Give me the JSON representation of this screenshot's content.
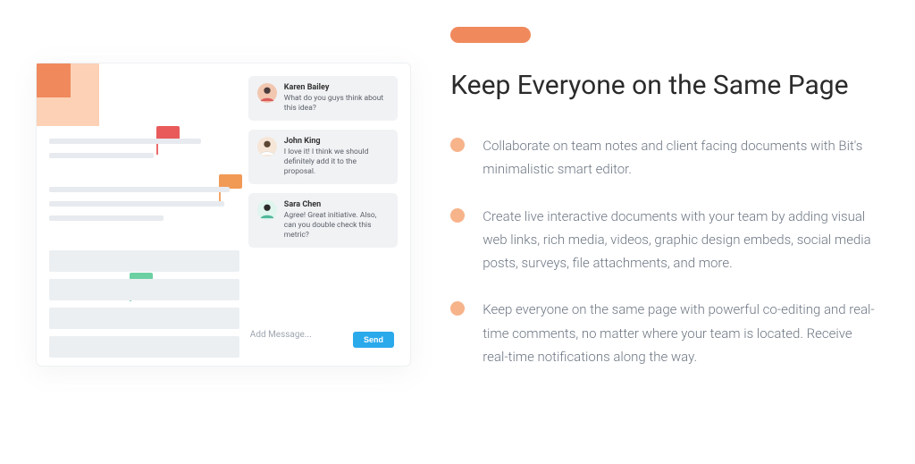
{
  "headline": "Keep Everyone on the Same Page",
  "features": [
    "Collaborate on team notes and client facing documents with Bit's minimalistic smart editor.",
    "Create live interactive documents with your team by adding visual web links, rich media, videos, graphic design embeds, social media posts, surveys, file attachments, and more.",
    "Keep everyone on the same page with powerful co-editing and real-time comments, no matter where your team is located. Receive real-time notifications along the way."
  ],
  "comments": [
    {
      "name": "Karen Bailey",
      "text": "What do you guys think about this idea?"
    },
    {
      "name": "John King",
      "text": "I love it! I think we should definitely add it to the proposal."
    },
    {
      "name": "Sara Chen",
      "text": "Agree! Great initiative. Also, can you double check this metric?"
    }
  ],
  "compose": {
    "placeholder": "Add Message...",
    "send_label": "Send"
  }
}
